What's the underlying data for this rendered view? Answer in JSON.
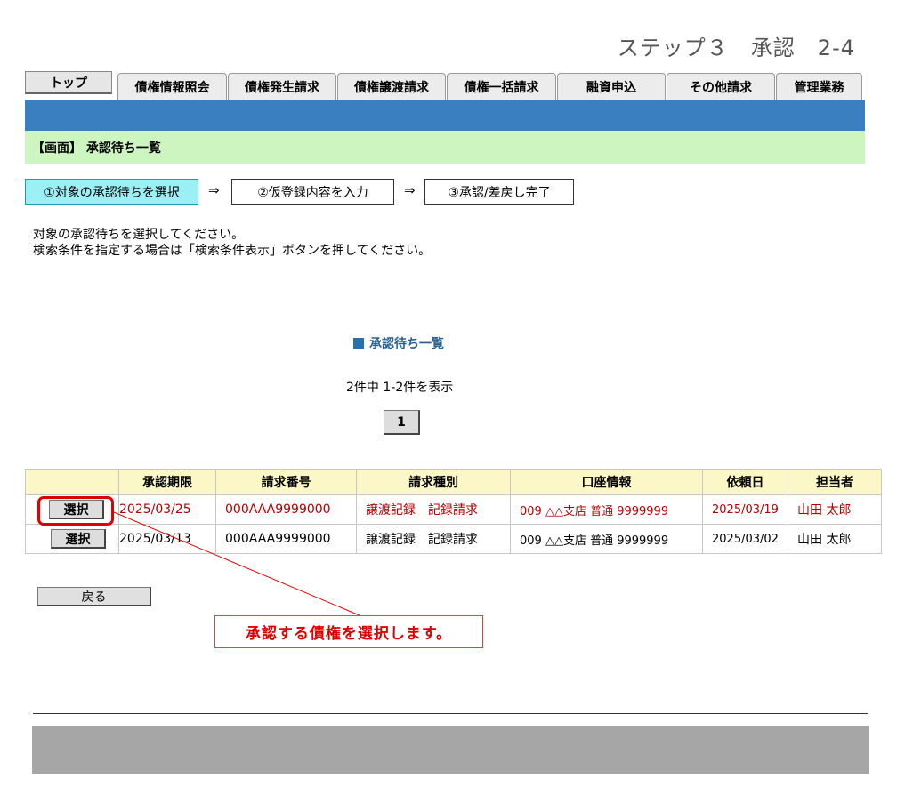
{
  "header": {
    "step_title": "ステップ３　承認　2-4"
  },
  "tabs": [
    {
      "label": "トップ"
    },
    {
      "label": "債権情報照会"
    },
    {
      "label": "債権発生請求"
    },
    {
      "label": "債権譲渡請求"
    },
    {
      "label": "債権一括請求"
    },
    {
      "label": "融資申込"
    },
    {
      "label": "その他請求"
    },
    {
      "label": "管理業務"
    }
  ],
  "screen_label": "【画面】 承認待ち一覧",
  "steps": [
    {
      "label": "①対象の承認待ちを選択"
    },
    {
      "label": "②仮登録内容を入力"
    },
    {
      "label": "③承認/差戻し完了"
    }
  ],
  "arrow_symbol": "⇒",
  "instructions": [
    "対象の承認待ちを選択してください。",
    "検索条件を指定する場合は「検索条件表示」ボタンを押してください。"
  ],
  "list": {
    "title": "承認待ち一覧",
    "count_text": "2件中 1-2件を表示",
    "page_number": "1"
  },
  "table": {
    "headers": [
      "",
      "承認期限",
      "請求番号",
      "請求種別",
      "口座情報",
      "依頼日",
      "担当者"
    ],
    "select_label": "選択",
    "rows": [
      {
        "deadline": "2025/03/25",
        "request_no": "000AAA9999000",
        "type": "譲渡記録　記録請求",
        "account": "009 △△支店 普通 9999999",
        "request_date": "2025/03/19",
        "person": "山田 太郎"
      },
      {
        "deadline": "2025/03/13",
        "request_no": "000AAA9999000",
        "type": "譲渡記録　記録請求",
        "account": "009 △△支店 普通 9999999",
        "request_date": "2025/03/02",
        "person": "山田 太郎"
      }
    ]
  },
  "back_label": "戻る",
  "callout": {
    "text": "承認する債権を選択します。"
  },
  "colors": {
    "tab_bar": "#3a7fbf",
    "screen_bar": "#ccf5c0",
    "active_step": "#9cf0f5",
    "header_row": "#fbf7c6",
    "callout": "#e00000",
    "footer": "#a6a6a6"
  }
}
